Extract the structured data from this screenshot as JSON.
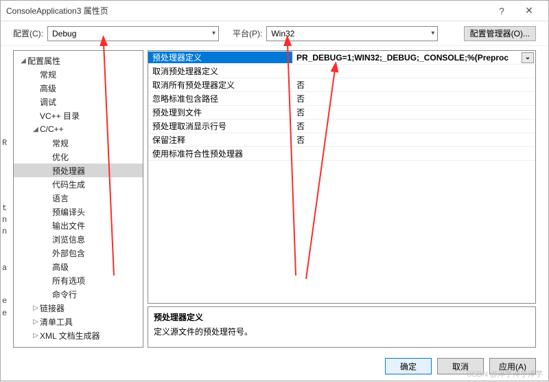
{
  "titlebar": {
    "title": "ConsoleApplication3 属性页",
    "help": "?",
    "close": "✕"
  },
  "configRow": {
    "configLabel": "配置(C):",
    "configValue": "Debug",
    "platformLabel": "平台(P):",
    "platformValue": "Win32",
    "configMgr": "配置管理器(O)..."
  },
  "tree": {
    "items": [
      {
        "depth": 0,
        "tw": "◢",
        "label": "配置属性"
      },
      {
        "depth": 1,
        "tw": "",
        "label": "常规"
      },
      {
        "depth": 1,
        "tw": "",
        "label": "高级"
      },
      {
        "depth": 1,
        "tw": "",
        "label": "调试"
      },
      {
        "depth": 1,
        "tw": "",
        "label": "VC++ 目录"
      },
      {
        "depth": 1,
        "tw": "◢",
        "label": "C/C++"
      },
      {
        "depth": 2,
        "tw": "",
        "label": "常规"
      },
      {
        "depth": 2,
        "tw": "",
        "label": "优化"
      },
      {
        "depth": 2,
        "tw": "",
        "label": "预处理器",
        "selected": true
      },
      {
        "depth": 2,
        "tw": "",
        "label": "代码生成"
      },
      {
        "depth": 2,
        "tw": "",
        "label": "语言"
      },
      {
        "depth": 2,
        "tw": "",
        "label": "预编译头"
      },
      {
        "depth": 2,
        "tw": "",
        "label": "输出文件"
      },
      {
        "depth": 2,
        "tw": "",
        "label": "浏览信息"
      },
      {
        "depth": 2,
        "tw": "",
        "label": "外部包含"
      },
      {
        "depth": 2,
        "tw": "",
        "label": "高级"
      },
      {
        "depth": 2,
        "tw": "",
        "label": "所有选项"
      },
      {
        "depth": 2,
        "tw": "",
        "label": "命令行"
      },
      {
        "depth": 1,
        "tw": "▷",
        "label": "链接器"
      },
      {
        "depth": 1,
        "tw": "▷",
        "label": "清单工具"
      },
      {
        "depth": 1,
        "tw": "▷",
        "label": "XML 文档生成器"
      }
    ]
  },
  "grid": {
    "rows": [
      {
        "name": "预处理器定义",
        "value": "PR_DEBUG=1;WIN32;_DEBUG;_CONSOLE;%(Preproc",
        "selected": true,
        "edit": true
      },
      {
        "name": "取消预处理器定义",
        "value": ""
      },
      {
        "name": "取消所有预处理器定义",
        "value": "否"
      },
      {
        "name": "忽略标准包含路径",
        "value": "否"
      },
      {
        "name": "预处理到文件",
        "value": "否"
      },
      {
        "name": "预处理取消显示行号",
        "value": "否"
      },
      {
        "name": "保留注释",
        "value": "否"
      },
      {
        "name": "使用标准符合性预处理器",
        "value": ""
      }
    ]
  },
  "desc": {
    "header": "预处理器定义",
    "body": "定义源文件的预处理符号。"
  },
  "footer": {
    "ok": "确定",
    "cancel": "取消",
    "apply": "应用(A)"
  },
  "watermark": "CSDN @洋芋洋芋洋芋",
  "ghost": {
    "a": "R",
    "b": "t",
    "c": "n",
    "d": "n",
    "e": "a",
    "f": "e",
    "g": "e"
  }
}
